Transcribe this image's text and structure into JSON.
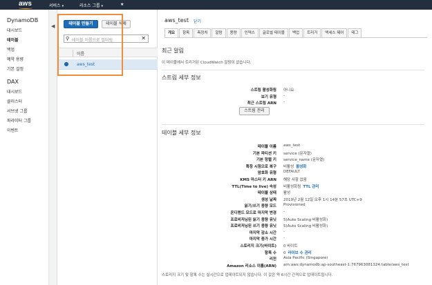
{
  "topbar": {
    "logo": "aws",
    "services": "서비스",
    "resource_groups": "리소스 그룹",
    "pin": "★"
  },
  "sidebar": {
    "dynamodb_title": "DynamoDB",
    "dynamodb_items": [
      "대시보드",
      "테이블",
      "백업",
      "예약 용량",
      "기본 설정"
    ],
    "dax_title": "DAX",
    "dax_items": [
      "대시보드",
      "클러스터",
      "서브넷 그룹",
      "파라미터 그룹",
      "이벤트"
    ]
  },
  "left_pane": {
    "create_table": "테이블 만들기",
    "delete_table": "테이블 삭제",
    "search_placeholder": "테이블 이름으로 필터링",
    "column_name": "이름",
    "rows": [
      "aws_test"
    ]
  },
  "main": {
    "title": "aws_test",
    "close": "닫기",
    "tabs": [
      "개요",
      "항목",
      "측정치",
      "알람",
      "용량",
      "인덱스",
      "글로벌 테이블",
      "백업",
      "트리거",
      "액세스 제어",
      "태그"
    ],
    "recent_alarms_title": "최근 알림",
    "recent_alarms_note": "이 테이블에서 트리거된 CloudWatch 알람이 없습니다.",
    "stream_title": "스트림 세부 정보",
    "stream": [
      {
        "label": "스트림 활성화됨",
        "value": "아니요"
      },
      {
        "label": "보기 유형",
        "value": "-"
      },
      {
        "label": "최근 스트림 ARN",
        "value": "-"
      }
    ],
    "stream_button": "스트림 관리",
    "table_title": "테이블 세부 정보",
    "table": [
      {
        "label": "테이블 이름",
        "value": "aws_test",
        "link": ""
      },
      {
        "label": "기본 파티션 키",
        "value": "service (문자열)",
        "link": ""
      },
      {
        "label": "기본 정렬 키",
        "value": "service_name (문자열)",
        "link": ""
      },
      {
        "label": "특정 시점으로 복구",
        "value": "비활성",
        "link": "활성화"
      },
      {
        "label": "암호화 유형",
        "value": "DEFAULT",
        "link": ""
      },
      {
        "label": "KMS 마스터 키 ARN",
        "value": "해당 사항 없음",
        "link": ""
      },
      {
        "label": "TTL(Time to live) 속성",
        "value": "비활성화됨",
        "link": "TTL 관리"
      },
      {
        "label": "테이블 상태",
        "value": "활성",
        "link": ""
      },
      {
        "label": "생성 날짜",
        "value": "2019년 2월 12일 오후 1시 14분 57초 UTC+9",
        "link": ""
      },
      {
        "label": "읽기/쓰기 용량 모드",
        "value": "Provisioned",
        "link": ""
      },
      {
        "label": "온디맨드 모드로 마지막 변경",
        "value": "-",
        "link": ""
      },
      {
        "label": "프로비저닝된 읽기 용량 유닛",
        "value": "5(Auto Scaling 비활성화)",
        "link": ""
      },
      {
        "label": "프로비저닝된 쓰기 용량 유닛",
        "value": "5(Auto Scaling 비활성화)",
        "link": ""
      },
      {
        "label": "마지막 감소 시간",
        "value": "-",
        "link": ""
      },
      {
        "label": "마지막 증가 시간",
        "value": "-",
        "link": ""
      },
      {
        "label": "스토리지 크기(바이트)",
        "value": "0 바이트",
        "link": ""
      },
      {
        "label": "항목 수",
        "value": "0",
        "link": "라이브 수 관리"
      },
      {
        "label": "리전",
        "value": "Asia Pacific (Singapore)",
        "link": ""
      },
      {
        "label": "Amazon 리소스 이름(ARN)",
        "value": "arn:aws:dynamodb:ap-southeast-1:767963081324:table/aws_test",
        "link": ""
      }
    ],
    "footer_note": "스토리지 크기 및 항목 수는 실시간으로 업데이트되지 않습니다. 이 값은 약 6시간 간격으로 업데이트됩니다."
  }
}
